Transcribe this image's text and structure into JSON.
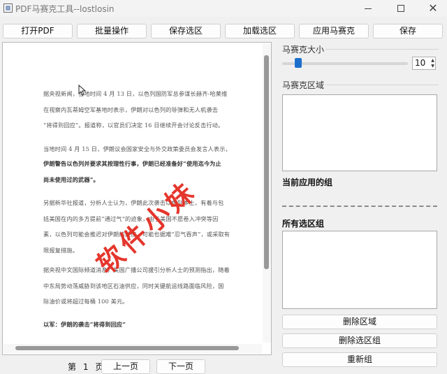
{
  "window": {
    "title": "PDF马赛克工具--lostlosin",
    "minimize_glyph": "",
    "close_glyph": "✕"
  },
  "toolbar": {
    "open_pdf": "打开PDF",
    "batch": "批量操作",
    "save_selection": "保存选区",
    "load_selection": "加载选区",
    "apply_mosaic": "应用马赛克",
    "save": "保存"
  },
  "document": {
    "paragraphs": [
      [
        "据央视新闻，当地时间 4 月 13 日，以色列国防军总参谋长赫齐-哈莱维",
        "在视察内瓦蒂姆空军基地时表示，伊朗对以色列的导弹和无人机袭击",
        "“将得到回应”。报道称，以官员们决定 16 日继续开会讨论反击行动。"
      ],
      [
        "当地时间 4 月 15 日，伊朗议会国家安全与外交政策委员会发言人表示，"
      ],
      [
        "伊朗警告以色列并要求其按理性行事，伊朗已经准备好“使用迄今为止",
        "尚未使用过的武器”。"
      ],
      [
        "另据新华社报道，分析人士认为，伊朗此次袭击以色列本土，有着与包",
        "括美国在内的多方提前“通过气”的迹象，由于美国不愿卷入冲突等因",
        "素，以色列可能会推迟对伊朗的反应，可能也据难“忍气吞声”，或采取有",
        "限报复措施。"
      ],
      [
        "据央视中文国际频道消息，美国广播公司援引分析人士的预测指出，随着",
        "中东局势动荡威胁到该地区石油供应，同时关键航运线路面临风险，国",
        "际油价或将超过每桶 100 美元。"
      ],
      [
        "以军：伊朗的袭击“将得到回应”"
      ]
    ],
    "watermark_text": "软件小妹"
  },
  "pagination": {
    "page_prefix": "第",
    "page_number": "1",
    "page_suffix": "页",
    "prev": "上一页",
    "next": "下一页"
  },
  "right_panel": {
    "mosaic_size_label": "马赛克大小",
    "mosaic_size_value": "10",
    "mosaic_size_fraction": 0.1,
    "mosaic_area_label": "马赛克区域",
    "current_group_label": "当前应用的组",
    "all_groups_label": "所有选区组",
    "delete_area": "删除区域",
    "delete_group": "删除选区组",
    "reset": "重新组"
  },
  "colors": {
    "accent": "#1e6fcc",
    "watermark": "#e3261b"
  }
}
